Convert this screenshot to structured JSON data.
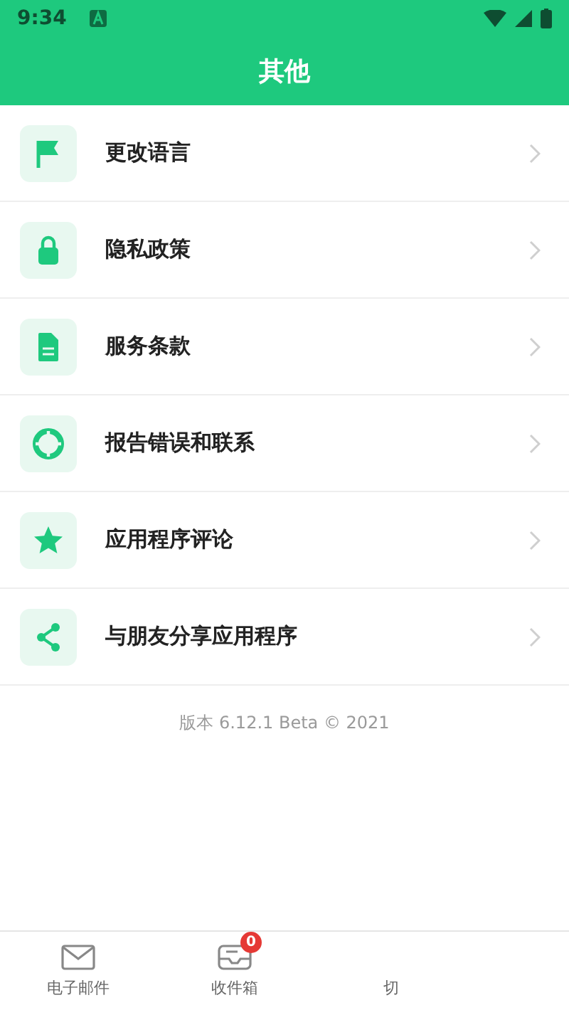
{
  "status_bar": {
    "time": "9:34"
  },
  "header": {
    "title": "其他"
  },
  "menu": [
    {
      "kind": "flag",
      "label": "更改语言"
    },
    {
      "kind": "lock",
      "label": "隐私政策"
    },
    {
      "kind": "document",
      "label": "服务条款"
    },
    {
      "kind": "lifebuoy",
      "label": "报告错误和联系"
    },
    {
      "kind": "star",
      "label": "应用程序评论"
    },
    {
      "kind": "share",
      "label": "与朋友分享应用程序"
    }
  ],
  "version": "版本 6.12.1 Beta © 2021",
  "bottom_nav": [
    {
      "kind": "mail",
      "label": "电子邮件"
    },
    {
      "kind": "inbox",
      "label": "收件箱",
      "badge": "0"
    },
    {
      "kind": "none",
      "label": "切"
    }
  ]
}
